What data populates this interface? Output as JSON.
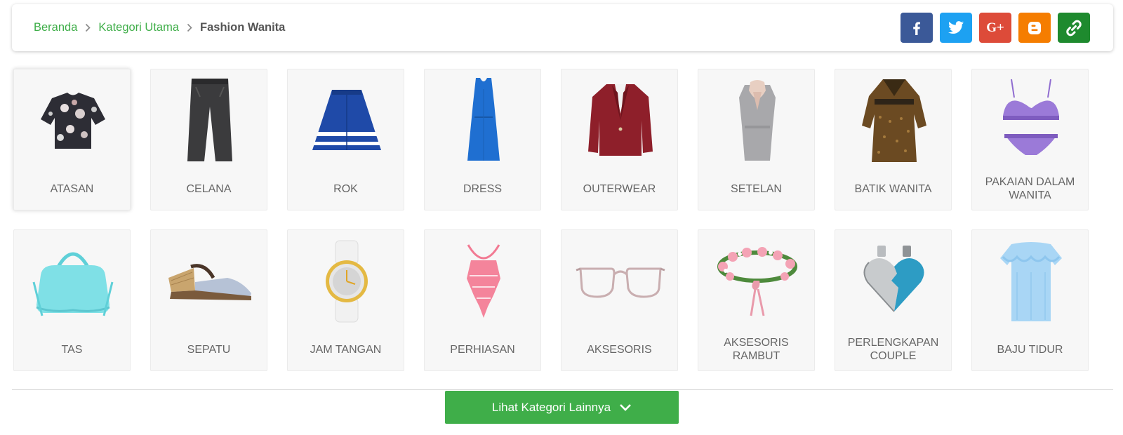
{
  "breadcrumb": {
    "home": "Beranda",
    "parent": "Kategori Utama",
    "current": "Fashion Wanita"
  },
  "share": [
    {
      "name": "facebook-icon",
      "color": "#3b5998"
    },
    {
      "name": "twitter-icon",
      "color": "#1da1f2"
    },
    {
      "name": "google-plus-icon",
      "color": "#dd4b39"
    },
    {
      "name": "blogger-icon",
      "color": "#f57d00"
    },
    {
      "name": "link-icon",
      "color": "#1e8a2e"
    }
  ],
  "share_labels": {
    "google_plus": "G+"
  },
  "categories": [
    {
      "label": "ATASAN",
      "icon": "blouse-icon"
    },
    {
      "label": "CELANA",
      "icon": "pants-icon"
    },
    {
      "label": "ROK",
      "icon": "skirt-icon"
    },
    {
      "label": "DRESS",
      "icon": "dress-icon"
    },
    {
      "label": "OUTERWEAR",
      "icon": "blazer-icon"
    },
    {
      "label": "SETELAN",
      "icon": "suit-set-icon"
    },
    {
      "label": "BATIK WANITA",
      "icon": "batik-dress-icon"
    },
    {
      "label": "PAKAIAN DALAM WANITA",
      "icon": "lingerie-icon"
    },
    {
      "label": "TAS",
      "icon": "handbag-icon"
    },
    {
      "label": "SEPATU",
      "icon": "wedge-sandal-icon"
    },
    {
      "label": "JAM TANGAN",
      "icon": "wristwatch-icon"
    },
    {
      "label": "PERHIASAN",
      "icon": "necklace-icon"
    },
    {
      "label": "AKSESORIS",
      "icon": "eyeglasses-icon"
    },
    {
      "label": "AKSESORIS RAMBUT",
      "icon": "flower-crown-icon"
    },
    {
      "label": "PERLENGKAPAN COUPLE",
      "icon": "heart-pendant-icon"
    },
    {
      "label": "BAJU TIDUR",
      "icon": "nightgown-icon"
    }
  ],
  "colors": {
    "accent": "#3fae49"
  },
  "more_button": {
    "label": "Lihat Kategori Lainnya"
  }
}
